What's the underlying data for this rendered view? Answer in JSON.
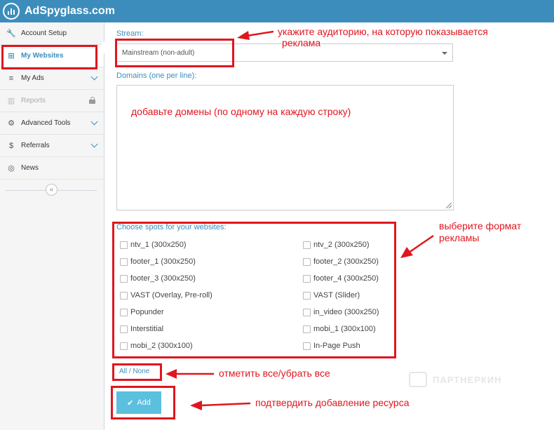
{
  "brand": {
    "name": "AdSpyglass.com"
  },
  "sidebar": {
    "items": [
      {
        "label": "Account Setup",
        "icon": "wrench-icon",
        "glyph": "🔧"
      },
      {
        "label": "My Websites",
        "icon": "sitemap-icon",
        "glyph": "⊞"
      },
      {
        "label": "My Ads",
        "icon": "sliders-icon",
        "glyph": "≡"
      },
      {
        "label": "Reports",
        "icon": "bar-chart-icon",
        "glyph": "▥"
      },
      {
        "label": "Advanced Tools",
        "icon": "gears-icon",
        "glyph": "⚙"
      },
      {
        "label": "Referrals",
        "icon": "money-icon",
        "glyph": "$"
      },
      {
        "label": "News",
        "icon": "lifebuoy-icon",
        "glyph": "◎"
      }
    ],
    "collapse_glyph": "«"
  },
  "form": {
    "stream_label": "Stream:",
    "stream_value": "Mainstream (non-adult)",
    "domains_label": "Domains (one per line):",
    "spots_label": "Choose spots for your websites:",
    "spots_left": [
      "ntv_1 (300x250)",
      "footer_1 (300x250)",
      "footer_3 (300x250)",
      "VAST (Overlay, Pre-roll)",
      "Popunder",
      "Interstitial",
      "mobi_2 (300x100)"
    ],
    "spots_right": [
      "ntv_2 (300x250)",
      "footer_2 (300x250)",
      "footer_4 (300x250)",
      "VAST (Slider)",
      "in_video (300x250)",
      "mobi_1 (300x100)",
      "In-Page Push"
    ],
    "all_none_label": "All / None",
    "add_label": "Add"
  },
  "annotations": {
    "stream_note_line1": "укажите аудиторию, на которую показывается",
    "stream_note_line2": "реклама",
    "domains_note": "добавьте домены (по одному на каждую строку)",
    "format_note_line1": "выберите формат",
    "format_note_line2": "рекламы",
    "all_none_note": "отметить все/убрать все",
    "add_note": "подтвердить добавление ресурса"
  },
  "watermark": {
    "text": "ПАРТНЕРКИН"
  },
  "colors": {
    "topbar": "#3c8dbc",
    "accent": "#3c8dbc",
    "annotation_red": "#e0161e",
    "add_button": "#5bc0de"
  }
}
